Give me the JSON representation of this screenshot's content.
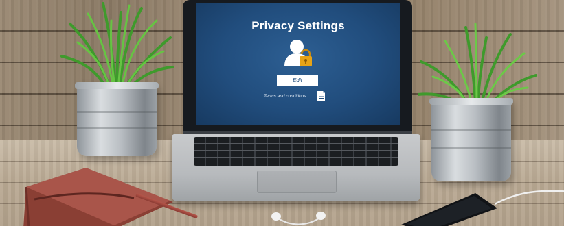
{
  "screen": {
    "title": "Privacy Settings",
    "edit_label": "Edit",
    "terms_label": "Terms and conditions"
  },
  "icons": {
    "user": "user-lock-icon",
    "document": "document-icon"
  },
  "colors": {
    "screen_blue": "#214d7d",
    "lock_gold": "#e6a317",
    "button_white": "#ffffff"
  }
}
